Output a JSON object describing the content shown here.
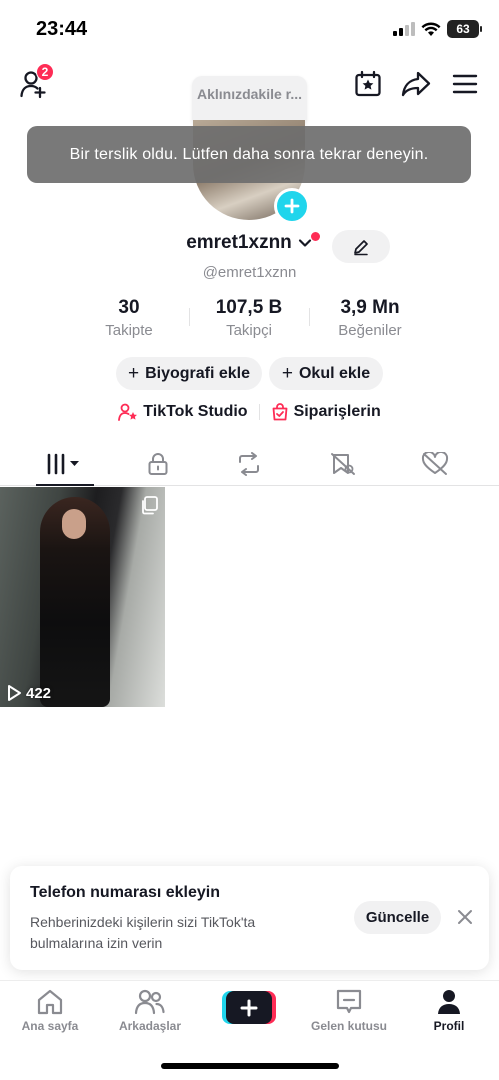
{
  "status_bar": {
    "time": "23:44",
    "battery": "63"
  },
  "header": {
    "notification_count": "2",
    "username_bubble": "Aklınızdakile r..."
  },
  "toast": {
    "message": "Bir terslik oldu. Lütfen daha sonra tekrar deneyin."
  },
  "profile": {
    "display_name": "emret1xznn",
    "handle": "@emret1xznn",
    "stats": [
      {
        "value": "30",
        "label": "Takipte"
      },
      {
        "value": "107,5 B",
        "label": "Takipçi"
      },
      {
        "value": "3,9 Mn",
        "label": "Beğeniler"
      }
    ],
    "add_bio_label": "Biyografi ekle",
    "add_school_label": "Okul ekle",
    "studio_label": "TikTok Studio",
    "orders_label": "Siparişlerin"
  },
  "tabs": [
    {
      "icon": "videos-grid-icon"
    },
    {
      "icon": "lock-icon"
    },
    {
      "icon": "repost-icon"
    },
    {
      "icon": "favorites-icon"
    },
    {
      "icon": "liked-icon"
    }
  ],
  "videos": [
    {
      "views": "422"
    }
  ],
  "card": {
    "title": "Telefon numarası ekleyin",
    "body": "Rehberinizdeki kişilerin sizi TikTok'ta bulmalarına izin verin",
    "button": "Güncelle"
  },
  "nav": {
    "home": "Ana sayfa",
    "friends": "Arkadaşlar",
    "inbox": "Gelen kutusu",
    "profile": "Profil"
  },
  "colors": {
    "accent_red": "#fe2c55",
    "accent_cyan": "#20d5ec",
    "text_primary": "#161823",
    "text_secondary": "#8a8b91"
  }
}
